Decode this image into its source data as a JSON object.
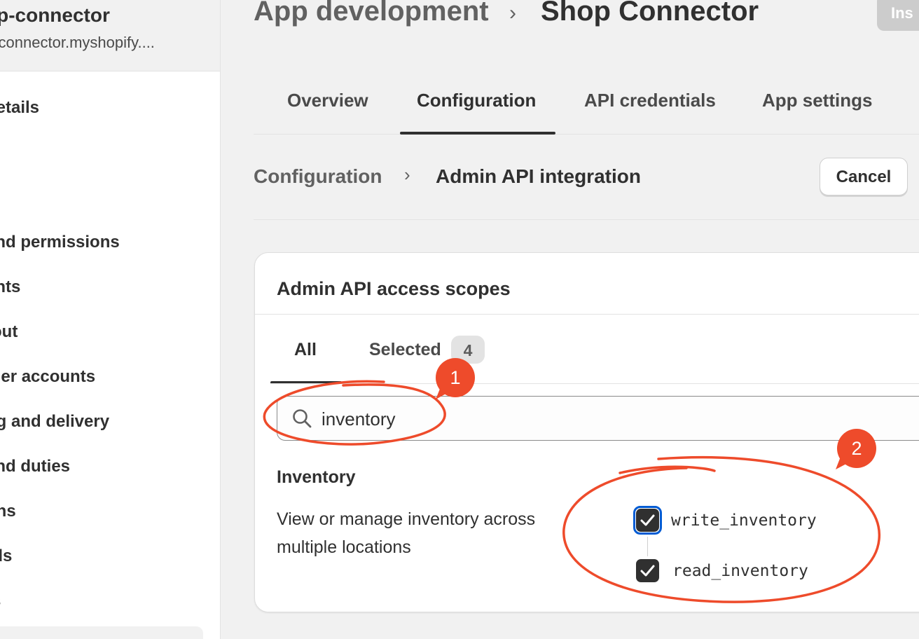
{
  "sidebar": {
    "store_name": "op-connector",
    "store_domain": "o-connector.myshopify....",
    "items": [
      {
        "label": "details"
      },
      {
        "label": "and permissions"
      },
      {
        "label": "ents"
      },
      {
        "label": "tout"
      },
      {
        "label": "mer accounts"
      },
      {
        "label": "ng and delivery"
      },
      {
        "label": "and duties"
      },
      {
        "label": "ons"
      },
      {
        "label": "rds"
      },
      {
        "label": "ts"
      }
    ]
  },
  "header": {
    "breadcrumb_parent": "App development",
    "breadcrumb_separator": "›",
    "breadcrumb_current": "Shop Connector",
    "install_label": "Ins"
  },
  "tabs": [
    {
      "label": "Overview"
    },
    {
      "label": "Configuration"
    },
    {
      "label": "API credentials"
    },
    {
      "label": "App settings"
    }
  ],
  "active_tab": "Configuration",
  "subheader": {
    "parent": "Configuration",
    "separator": "›",
    "current": "Admin API integration",
    "cancel_label": "Cancel"
  },
  "scopes_card": {
    "title": "Admin API access scopes",
    "tab_all": "All",
    "tab_selected": "Selected",
    "selected_count": "4",
    "search_value": "inventory",
    "group_title": "Inventory",
    "group_description": "View or manage inventory across multiple locations",
    "scopes": [
      {
        "name": "write_inventory",
        "checked": true,
        "focused": true
      },
      {
        "name": "read_inventory",
        "checked": true,
        "focused": false
      }
    ]
  },
  "annotations": {
    "marker_1": "1",
    "marker_2": "2",
    "color": "#ee4b2b"
  },
  "colors": {
    "text": "#303030",
    "focus": "#005bd3",
    "checkbox": "#303030"
  },
  "icons": [
    "search-icon",
    "checkmark-icon",
    "chevron-right-icon"
  ]
}
